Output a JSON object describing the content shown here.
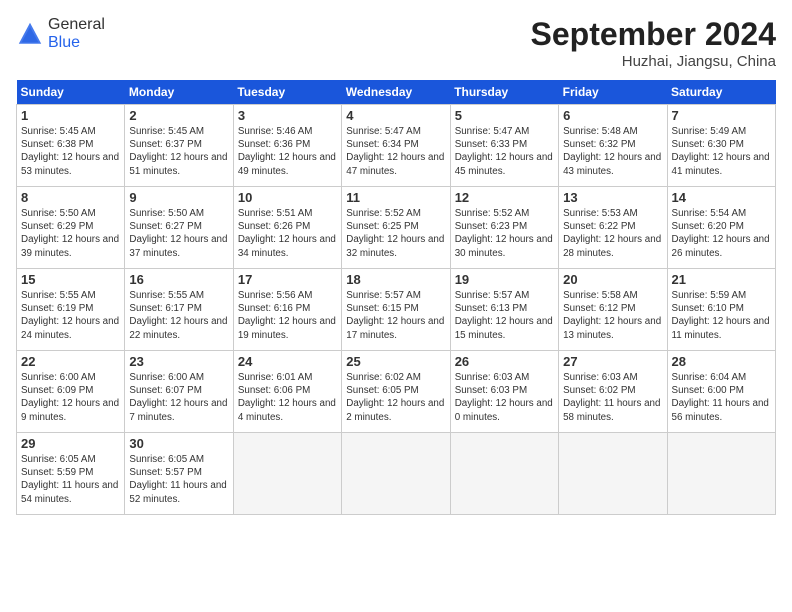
{
  "header": {
    "logo_general": "General",
    "logo_blue": "Blue",
    "month_title": "September 2024",
    "location": "Huzhai, Jiangsu, China"
  },
  "calendar": {
    "weekdays": [
      "Sunday",
      "Monday",
      "Tuesday",
      "Wednesday",
      "Thursday",
      "Friday",
      "Saturday"
    ],
    "weeks": [
      [
        {
          "day": "",
          "empty": true
        },
        {
          "day": "",
          "empty": true
        },
        {
          "day": "",
          "empty": true
        },
        {
          "day": "",
          "empty": true
        },
        {
          "day": "5",
          "sunrise": "5:47 AM",
          "sunset": "6:33 PM",
          "daylight": "12 hours and 45 minutes."
        },
        {
          "day": "6",
          "sunrise": "5:48 AM",
          "sunset": "6:32 PM",
          "daylight": "12 hours and 43 minutes."
        },
        {
          "day": "7",
          "sunrise": "5:49 AM",
          "sunset": "6:30 PM",
          "daylight": "12 hours and 41 minutes."
        }
      ],
      [
        {
          "day": "1",
          "sunrise": "5:45 AM",
          "sunset": "6:38 PM",
          "daylight": "12 hours and 53 minutes."
        },
        {
          "day": "2",
          "sunrise": "5:45 AM",
          "sunset": "6:37 PM",
          "daylight": "12 hours and 51 minutes."
        },
        {
          "day": "3",
          "sunrise": "5:46 AM",
          "sunset": "6:36 PM",
          "daylight": "12 hours and 49 minutes."
        },
        {
          "day": "4",
          "sunrise": "5:47 AM",
          "sunset": "6:34 PM",
          "daylight": "12 hours and 47 minutes."
        },
        {
          "day": "5",
          "sunrise": "5:47 AM",
          "sunset": "6:33 PM",
          "daylight": "12 hours and 45 minutes."
        },
        {
          "day": "6",
          "sunrise": "5:48 AM",
          "sunset": "6:32 PM",
          "daylight": "12 hours and 43 minutes."
        },
        {
          "day": "7",
          "sunrise": "5:49 AM",
          "sunset": "6:30 PM",
          "daylight": "12 hours and 41 minutes."
        }
      ],
      [
        {
          "day": "8",
          "sunrise": "5:50 AM",
          "sunset": "6:29 PM",
          "daylight": "12 hours and 39 minutes."
        },
        {
          "day": "9",
          "sunrise": "5:50 AM",
          "sunset": "6:27 PM",
          "daylight": "12 hours and 37 minutes."
        },
        {
          "day": "10",
          "sunrise": "5:51 AM",
          "sunset": "6:26 PM",
          "daylight": "12 hours and 34 minutes."
        },
        {
          "day": "11",
          "sunrise": "5:52 AM",
          "sunset": "6:25 PM",
          "daylight": "12 hours and 32 minutes."
        },
        {
          "day": "12",
          "sunrise": "5:52 AM",
          "sunset": "6:23 PM",
          "daylight": "12 hours and 30 minutes."
        },
        {
          "day": "13",
          "sunrise": "5:53 AM",
          "sunset": "6:22 PM",
          "daylight": "12 hours and 28 minutes."
        },
        {
          "day": "14",
          "sunrise": "5:54 AM",
          "sunset": "6:20 PM",
          "daylight": "12 hours and 26 minutes."
        }
      ],
      [
        {
          "day": "15",
          "sunrise": "5:55 AM",
          "sunset": "6:19 PM",
          "daylight": "12 hours and 24 minutes."
        },
        {
          "day": "16",
          "sunrise": "5:55 AM",
          "sunset": "6:17 PM",
          "daylight": "12 hours and 22 minutes."
        },
        {
          "day": "17",
          "sunrise": "5:56 AM",
          "sunset": "6:16 PM",
          "daylight": "12 hours and 19 minutes."
        },
        {
          "day": "18",
          "sunrise": "5:57 AM",
          "sunset": "6:15 PM",
          "daylight": "12 hours and 17 minutes."
        },
        {
          "day": "19",
          "sunrise": "5:57 AM",
          "sunset": "6:13 PM",
          "daylight": "12 hours and 15 minutes."
        },
        {
          "day": "20",
          "sunrise": "5:58 AM",
          "sunset": "6:12 PM",
          "daylight": "12 hours and 13 minutes."
        },
        {
          "day": "21",
          "sunrise": "5:59 AM",
          "sunset": "6:10 PM",
          "daylight": "12 hours and 11 minutes."
        }
      ],
      [
        {
          "day": "22",
          "sunrise": "6:00 AM",
          "sunset": "6:09 PM",
          "daylight": "12 hours and 9 minutes."
        },
        {
          "day": "23",
          "sunrise": "6:00 AM",
          "sunset": "6:07 PM",
          "daylight": "12 hours and 7 minutes."
        },
        {
          "day": "24",
          "sunrise": "6:01 AM",
          "sunset": "6:06 PM",
          "daylight": "12 hours and 4 minutes."
        },
        {
          "day": "25",
          "sunrise": "6:02 AM",
          "sunset": "6:05 PM",
          "daylight": "12 hours and 2 minutes."
        },
        {
          "day": "26",
          "sunrise": "6:03 AM",
          "sunset": "6:03 PM",
          "daylight": "12 hours and 0 minutes."
        },
        {
          "day": "27",
          "sunrise": "6:03 AM",
          "sunset": "6:02 PM",
          "daylight": "11 hours and 58 minutes."
        },
        {
          "day": "28",
          "sunrise": "6:04 AM",
          "sunset": "6:00 PM",
          "daylight": "11 hours and 56 minutes."
        }
      ],
      [
        {
          "day": "29",
          "sunrise": "6:05 AM",
          "sunset": "5:59 PM",
          "daylight": "11 hours and 54 minutes."
        },
        {
          "day": "30",
          "sunrise": "6:05 AM",
          "sunset": "5:57 PM",
          "daylight": "11 hours and 52 minutes."
        },
        {
          "day": "",
          "empty": true
        },
        {
          "day": "",
          "empty": true
        },
        {
          "day": "",
          "empty": true
        },
        {
          "day": "",
          "empty": true
        },
        {
          "day": "",
          "empty": true
        }
      ]
    ]
  }
}
